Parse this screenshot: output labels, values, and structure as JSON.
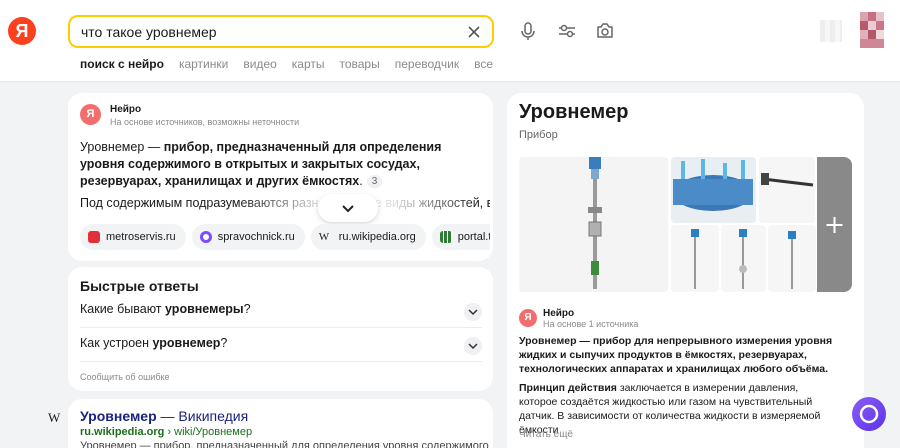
{
  "header": {
    "logo": "Я",
    "search_value": "что такое уровнемер",
    "tabs": [
      "поиск с нейро",
      "картинки",
      "видео",
      "карты",
      "товары",
      "переводчик",
      "все"
    ]
  },
  "neuro": {
    "logo": "Я",
    "name": "Нейро",
    "subtitle": "На основе источников, возможны неточности",
    "answer_term": "Уровнемер",
    "answer_dash": " — ",
    "answer_bold": "прибор, предназначенный для определения уровня содержимого в открытых и закрытых сосудах, резервуарах, хранилищах и других ёмкостях",
    "answer_end": ".",
    "citation": "3",
    "second_line": "Под содержимым подразумеваются разнообразные виды жидкостей, в",
    "chips": [
      "metroservis.ru",
      "spravochnick.ru",
      "ru.wikipedia.org",
      "portal.tpu"
    ],
    "colors": {
      "chip_icons": [
        "#e0303a",
        "#7c4dff",
        "#1a1a1a",
        "#2e7d32"
      ]
    }
  },
  "quick_answers": {
    "title": "Быстрые ответы",
    "q1_start": "Какие бывают ",
    "q1_bold": "уровнемеры",
    "q1_end": "?",
    "q2_start": "Как устроен ",
    "q2_bold": "уровнемер",
    "q2_end": "?",
    "report": "Сообщить об ошибке"
  },
  "wiki": {
    "icon": "W",
    "title_bold": "Уровнемер",
    "title_rest": " — Википедия",
    "url_bold": "ru.wikipedia.org",
    "url_rest": " › wiki/Уровнемер",
    "snippet": "Уровнемер — прибор, предназначенный для определения уровня содержимого"
  },
  "knowledge_panel": {
    "title": "Уровнемер",
    "subtitle": "Прибор",
    "neuro_name": "Нейро",
    "neuro_sub": "На основе 1 источника",
    "p1_bold": "Уровнемер — прибор для непрерывного измерения уровня жидких и сыпучих продуктов в ёмкостях, резервуарах, технологических аппаратах и хранилищах любого объёма.",
    "p2_bold": "Принцип действия",
    "p2_rest": " заключается в измерении давления, которое создаётся жидкостью или газом на чувствительный датчик. В зависимости от количества жидкости в измеряемой ёмкости",
    "read_more": "Читать ещё"
  },
  "colors": {
    "accent_yellow": "#ffcc00",
    "brand_red": "#fc3f1d",
    "link_blue": "#1a237e",
    "url_green": "#1b6f1b"
  }
}
